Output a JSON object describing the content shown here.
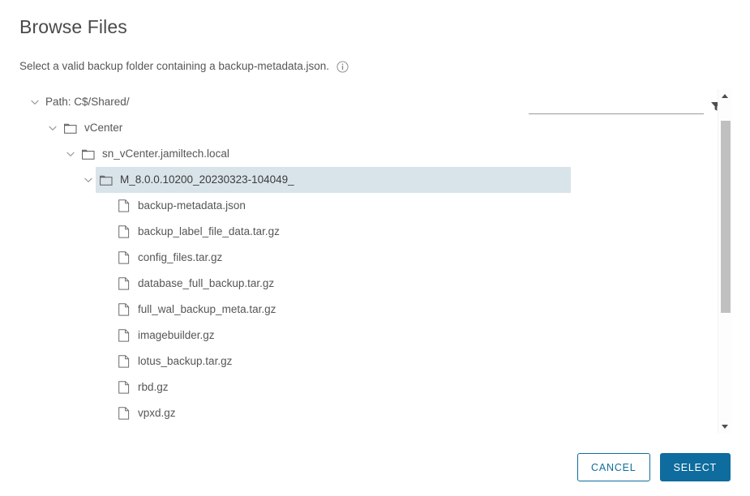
{
  "dialog": {
    "title": "Browse Files",
    "subtitle": "Select a valid backup folder containing a backup-metadata.json.",
    "info_icon": "info-circle-icon"
  },
  "filter": {
    "value": "",
    "placeholder": "",
    "icon": "filter-funnel-icon"
  },
  "tree": [
    {
      "label": "Path: C$/Shared/",
      "type": "root",
      "depth": 0,
      "expanded": true,
      "selected": false,
      "has_folder_icon": false
    },
    {
      "label": "vCenter",
      "type": "folder",
      "depth": 1,
      "expanded": true,
      "selected": false,
      "has_folder_icon": true
    },
    {
      "label": "sn_vCenter.jamiltech.local",
      "type": "folder",
      "depth": 2,
      "expanded": true,
      "selected": false,
      "has_folder_icon": true
    },
    {
      "label": "M_8.0.0.10200_20230323-104049_",
      "type": "folder",
      "depth": 3,
      "expanded": true,
      "selected": true,
      "has_folder_icon": true
    },
    {
      "label": "backup-metadata.json",
      "type": "file",
      "depth": 4,
      "expanded": false,
      "selected": false,
      "has_folder_icon": false
    },
    {
      "label": "backup_label_file_data.tar.gz",
      "type": "file",
      "depth": 4,
      "expanded": false,
      "selected": false,
      "has_folder_icon": false
    },
    {
      "label": "config_files.tar.gz",
      "type": "file",
      "depth": 4,
      "expanded": false,
      "selected": false,
      "has_folder_icon": false
    },
    {
      "label": "database_full_backup.tar.gz",
      "type": "file",
      "depth": 4,
      "expanded": false,
      "selected": false,
      "has_folder_icon": false
    },
    {
      "label": "full_wal_backup_meta.tar.gz",
      "type": "file",
      "depth": 4,
      "expanded": false,
      "selected": false,
      "has_folder_icon": false
    },
    {
      "label": "imagebuilder.gz",
      "type": "file",
      "depth": 4,
      "expanded": false,
      "selected": false,
      "has_folder_icon": false
    },
    {
      "label": "lotus_backup.tar.gz",
      "type": "file",
      "depth": 4,
      "expanded": false,
      "selected": false,
      "has_folder_icon": false
    },
    {
      "label": "rbd.gz",
      "type": "file",
      "depth": 4,
      "expanded": false,
      "selected": false,
      "has_folder_icon": false
    },
    {
      "label": "vpxd.gz",
      "type": "file",
      "depth": 4,
      "expanded": false,
      "selected": false,
      "has_folder_icon": false
    }
  ],
  "scrollbar": {
    "up_icon": "scroll-up-arrow-icon",
    "down_icon": "scroll-down-arrow-icon"
  },
  "footer": {
    "cancel_label": "CANCEL",
    "select_label": "SELECT"
  },
  "colors": {
    "accent": "#0f6c9e",
    "selection": "#d9e4ea",
    "text": "#565656"
  }
}
